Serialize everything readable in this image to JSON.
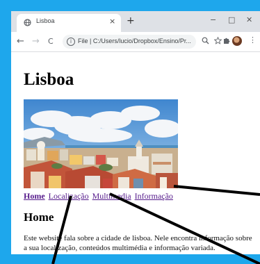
{
  "browser": {
    "tab_title": "Lisboa",
    "new_tab_symbol": "+",
    "close_symbol": "×",
    "window_controls": {
      "minimize": "−",
      "maximize": "□",
      "close": "✕"
    },
    "nav": {
      "back": "←",
      "forward": "→",
      "reload": "C"
    },
    "address": "File  |  C:/Users/lucio/Dropbox/Ensino/Pr..."
  },
  "page": {
    "title": "Lisboa",
    "nav_links": [
      {
        "label": "Home"
      },
      {
        "label": "Localização"
      },
      {
        "label": "Multimedia"
      },
      {
        "label": "Informação"
      }
    ],
    "section_title": "Home",
    "description": "Este website fala sobre a cidade de lisboa. Nele encontra informação sobre a sua localização, conteúdos multimédia e informação variada."
  },
  "colors": {
    "frame": "#1ea7ec",
    "visited_link": "#551a8b"
  },
  "icons": [
    "globe-favicon-icon",
    "info-icon",
    "zoom-icon",
    "star-icon",
    "extensions-icon",
    "avatar"
  ]
}
